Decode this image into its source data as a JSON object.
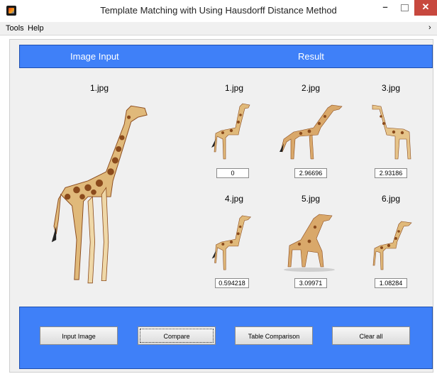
{
  "window": {
    "title": "Template Matching with Using Hausdorff Distance Method",
    "minimize_glyph": "–",
    "close_glyph": "✕"
  },
  "menu": {
    "items": [
      "Tools",
      "Help"
    ],
    "overflow_glyph": "›"
  },
  "header": {
    "left_label": "Image Input",
    "right_label": "Result"
  },
  "input_image": {
    "file": "1.jpg"
  },
  "results": [
    {
      "file": "1.jpg",
      "score": "0"
    },
    {
      "file": "2.jpg",
      "score": "2.96696"
    },
    {
      "file": "3.jpg",
      "score": "2.93186"
    },
    {
      "file": "4.jpg",
      "score": "0.594218"
    },
    {
      "file": "5.jpg",
      "score": "3.09971"
    },
    {
      "file": "6.jpg",
      "score": "1.08284"
    }
  ],
  "buttons": {
    "input_image": "Input Image",
    "compare": "Compare",
    "table_comparison": "Table Comparison",
    "clear_all": "Clear all"
  },
  "colors": {
    "panel_blue": "#3f80f8",
    "close_red": "#c7483e",
    "giraffe_body": "#e0b97a",
    "giraffe_spots": "#8a4a1c"
  }
}
